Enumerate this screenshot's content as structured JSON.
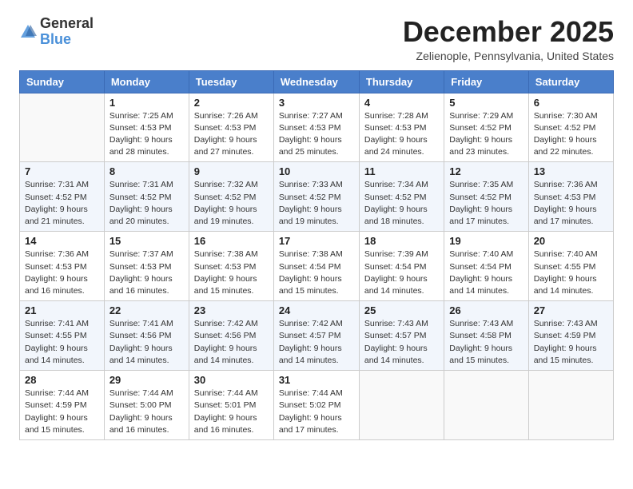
{
  "header": {
    "logo_general": "General",
    "logo_blue": "Blue",
    "month": "December 2025",
    "location": "Zelienople, Pennsylvania, United States"
  },
  "weekdays": [
    "Sunday",
    "Monday",
    "Tuesday",
    "Wednesday",
    "Thursday",
    "Friday",
    "Saturday"
  ],
  "weeks": [
    [
      {
        "day": "",
        "info": ""
      },
      {
        "day": "1",
        "info": "Sunrise: 7:25 AM\nSunset: 4:53 PM\nDaylight: 9 hours\nand 28 minutes."
      },
      {
        "day": "2",
        "info": "Sunrise: 7:26 AM\nSunset: 4:53 PM\nDaylight: 9 hours\nand 27 minutes."
      },
      {
        "day": "3",
        "info": "Sunrise: 7:27 AM\nSunset: 4:53 PM\nDaylight: 9 hours\nand 25 minutes."
      },
      {
        "day": "4",
        "info": "Sunrise: 7:28 AM\nSunset: 4:53 PM\nDaylight: 9 hours\nand 24 minutes."
      },
      {
        "day": "5",
        "info": "Sunrise: 7:29 AM\nSunset: 4:52 PM\nDaylight: 9 hours\nand 23 minutes."
      },
      {
        "day": "6",
        "info": "Sunrise: 7:30 AM\nSunset: 4:52 PM\nDaylight: 9 hours\nand 22 minutes."
      }
    ],
    [
      {
        "day": "7",
        "info": "Sunrise: 7:31 AM\nSunset: 4:52 PM\nDaylight: 9 hours\nand 21 minutes."
      },
      {
        "day": "8",
        "info": "Sunrise: 7:31 AM\nSunset: 4:52 PM\nDaylight: 9 hours\nand 20 minutes."
      },
      {
        "day": "9",
        "info": "Sunrise: 7:32 AM\nSunset: 4:52 PM\nDaylight: 9 hours\nand 19 minutes."
      },
      {
        "day": "10",
        "info": "Sunrise: 7:33 AM\nSunset: 4:52 PM\nDaylight: 9 hours\nand 19 minutes."
      },
      {
        "day": "11",
        "info": "Sunrise: 7:34 AM\nSunset: 4:52 PM\nDaylight: 9 hours\nand 18 minutes."
      },
      {
        "day": "12",
        "info": "Sunrise: 7:35 AM\nSunset: 4:52 PM\nDaylight: 9 hours\nand 17 minutes."
      },
      {
        "day": "13",
        "info": "Sunrise: 7:36 AM\nSunset: 4:53 PM\nDaylight: 9 hours\nand 17 minutes."
      }
    ],
    [
      {
        "day": "14",
        "info": "Sunrise: 7:36 AM\nSunset: 4:53 PM\nDaylight: 9 hours\nand 16 minutes."
      },
      {
        "day": "15",
        "info": "Sunrise: 7:37 AM\nSunset: 4:53 PM\nDaylight: 9 hours\nand 16 minutes."
      },
      {
        "day": "16",
        "info": "Sunrise: 7:38 AM\nSunset: 4:53 PM\nDaylight: 9 hours\nand 15 minutes."
      },
      {
        "day": "17",
        "info": "Sunrise: 7:38 AM\nSunset: 4:54 PM\nDaylight: 9 hours\nand 15 minutes."
      },
      {
        "day": "18",
        "info": "Sunrise: 7:39 AM\nSunset: 4:54 PM\nDaylight: 9 hours\nand 14 minutes."
      },
      {
        "day": "19",
        "info": "Sunrise: 7:40 AM\nSunset: 4:54 PM\nDaylight: 9 hours\nand 14 minutes."
      },
      {
        "day": "20",
        "info": "Sunrise: 7:40 AM\nSunset: 4:55 PM\nDaylight: 9 hours\nand 14 minutes."
      }
    ],
    [
      {
        "day": "21",
        "info": "Sunrise: 7:41 AM\nSunset: 4:55 PM\nDaylight: 9 hours\nand 14 minutes."
      },
      {
        "day": "22",
        "info": "Sunrise: 7:41 AM\nSunset: 4:56 PM\nDaylight: 9 hours\nand 14 minutes."
      },
      {
        "day": "23",
        "info": "Sunrise: 7:42 AM\nSunset: 4:56 PM\nDaylight: 9 hours\nand 14 minutes."
      },
      {
        "day": "24",
        "info": "Sunrise: 7:42 AM\nSunset: 4:57 PM\nDaylight: 9 hours\nand 14 minutes."
      },
      {
        "day": "25",
        "info": "Sunrise: 7:43 AM\nSunset: 4:57 PM\nDaylight: 9 hours\nand 14 minutes."
      },
      {
        "day": "26",
        "info": "Sunrise: 7:43 AM\nSunset: 4:58 PM\nDaylight: 9 hours\nand 15 minutes."
      },
      {
        "day": "27",
        "info": "Sunrise: 7:43 AM\nSunset: 4:59 PM\nDaylight: 9 hours\nand 15 minutes."
      }
    ],
    [
      {
        "day": "28",
        "info": "Sunrise: 7:44 AM\nSunset: 4:59 PM\nDaylight: 9 hours\nand 15 minutes."
      },
      {
        "day": "29",
        "info": "Sunrise: 7:44 AM\nSunset: 5:00 PM\nDaylight: 9 hours\nand 16 minutes."
      },
      {
        "day": "30",
        "info": "Sunrise: 7:44 AM\nSunset: 5:01 PM\nDaylight: 9 hours\nand 16 minutes."
      },
      {
        "day": "31",
        "info": "Sunrise: 7:44 AM\nSunset: 5:02 PM\nDaylight: 9 hours\nand 17 minutes."
      },
      {
        "day": "",
        "info": ""
      },
      {
        "day": "",
        "info": ""
      },
      {
        "day": "",
        "info": ""
      }
    ]
  ]
}
